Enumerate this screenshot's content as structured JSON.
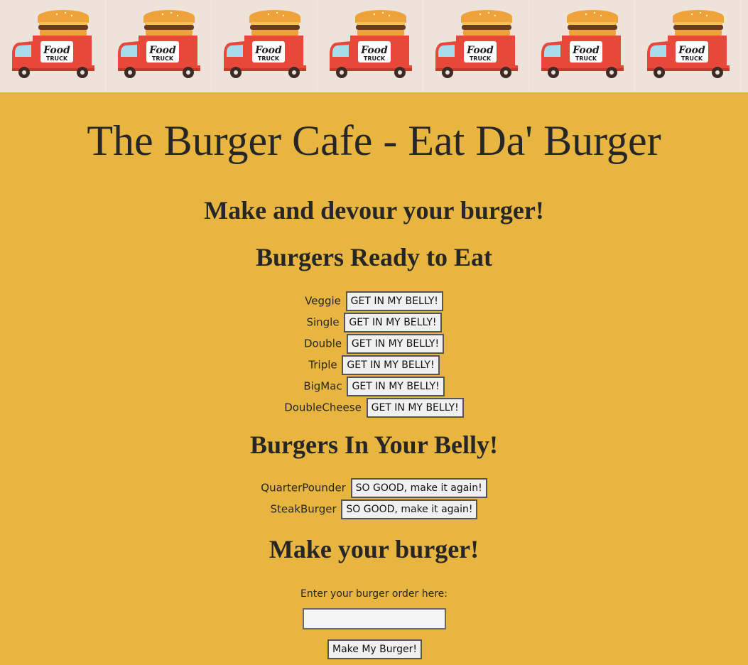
{
  "banner": {
    "tile_count": 7,
    "logo_line1": "Food",
    "logo_line2": "TRUCK",
    "colors": {
      "truck": "#e8483a",
      "bun": "#f0a23a",
      "patty": "#6b3a1f",
      "window": "#a8dced"
    }
  },
  "page": {
    "title": "The Burger Cafe - Eat Da' Burger",
    "subtitle": "Make and devour your burger!"
  },
  "ready": {
    "heading": "Burgers Ready to Eat",
    "button_label": "GET IN MY BELLY!",
    "items": [
      "Veggie",
      "Single",
      "Double",
      "Triple",
      "BigMac",
      "DoubleCheese"
    ]
  },
  "devoured": {
    "heading": "Burgers In Your Belly!",
    "button_label": "SO GOOD, make it again!",
    "items": [
      "QuarterPounder",
      "SteakBurger"
    ]
  },
  "form": {
    "heading": "Make your burger!",
    "label": "Enter your burger order here:",
    "input_value": "",
    "submit_label": "Make My Burger!"
  },
  "colors": {
    "background": "#e8b640",
    "banner_background": "#ede3d8"
  }
}
